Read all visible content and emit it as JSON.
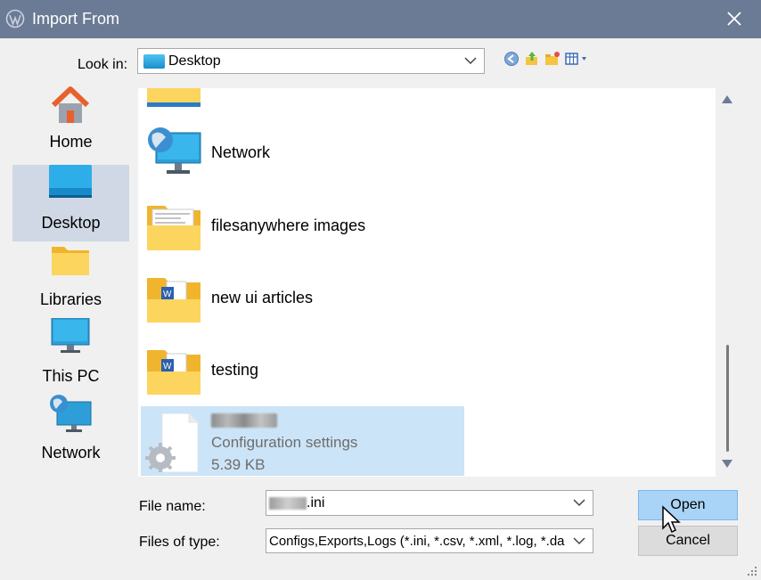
{
  "window": {
    "title": "Import From",
    "app_icon": "wordpress-logo-icon",
    "close_icon": "close-icon"
  },
  "look_in": {
    "label": "Look in:",
    "value": "Desktop",
    "toolbar_icons": [
      "back-icon",
      "up-folder-icon",
      "new-folder-icon",
      "view-menu-icon"
    ]
  },
  "places": [
    {
      "label": "Home",
      "icon": "home-icon",
      "selected": false
    },
    {
      "label": "Desktop",
      "icon": "desktop-icon",
      "selected": true
    },
    {
      "label": "Libraries",
      "icon": "libraries-icon",
      "selected": false
    },
    {
      "label": "This PC",
      "icon": "this-pc-icon",
      "selected": false
    },
    {
      "label": "Network",
      "icon": "network-icon",
      "selected": false
    }
  ],
  "files": [
    {
      "name": "Network",
      "icon": "network-icon"
    },
    {
      "name": "filesanywhere images",
      "icon": "folder-icon"
    },
    {
      "name": "new ui articles",
      "icon": "folder-word-icon"
    },
    {
      "name": "testing",
      "icon": "folder-word-icon"
    }
  ],
  "selected_file": {
    "type": "Configuration settings",
    "size": "5.39 KB",
    "icon": "config-file-icon"
  },
  "file_name": {
    "label": "File name:",
    "value_suffix": ".ini"
  },
  "file_type": {
    "label": "Files of type:",
    "value": "Configs,Exports,Logs (*.ini, *.csv, *.xml, *.log, *.da"
  },
  "buttons": {
    "open": "Open",
    "cancel": "Cancel"
  }
}
